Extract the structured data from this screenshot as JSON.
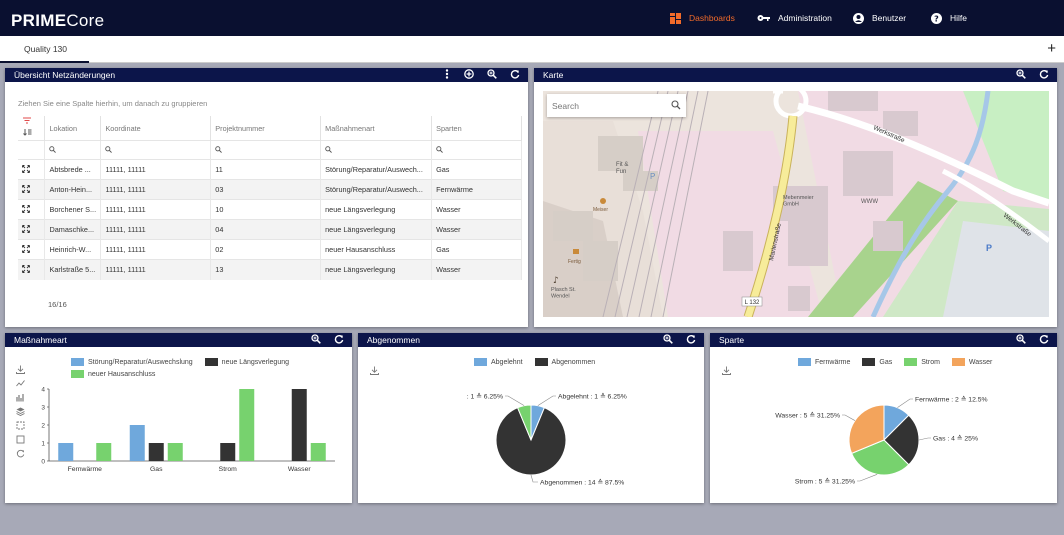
{
  "app": {
    "logo_bold": "PRIME",
    "logo_light": "Core",
    "nav": [
      {
        "label": "Dashboards",
        "icon": "dashboard-icon",
        "active": true
      },
      {
        "label": "Administration",
        "icon": "key-icon",
        "active": false
      },
      {
        "label": "Benutzer",
        "icon": "user-icon",
        "active": false
      },
      {
        "label": "Hilfe",
        "icon": "help-icon",
        "active": false
      }
    ],
    "accent": "#f26b2a",
    "header_color": "#0a1030"
  },
  "tabs": [
    {
      "label": "Quality 130"
    }
  ],
  "table_panel": {
    "title": "Übersicht Netzänderungen",
    "group_hint": "Ziehen Sie eine Spalte hierhin, um danach zu gruppieren",
    "columns": [
      "Lokation",
      "Koordinate",
      "Projektnummer",
      "Maßnahmenart",
      "Sparten"
    ],
    "rows": [
      [
        "Abtsbrede ...",
        "11111, 11111",
        "11",
        "Störung/Reparatur/Auswech...",
        "Gas"
      ],
      [
        "Anton-Hein...",
        "11111, 11111",
        "03",
        "Störung/Reparatur/Auswech...",
        "Fernwärme"
      ],
      [
        "Borchener S...",
        "11111, 11111",
        "10",
        "neue Längsverlegung",
        "Wasser"
      ],
      [
        "Damaschke...",
        "11111, 11111",
        "04",
        "neue Längsverlegung",
        "Wasser"
      ],
      [
        "Heinrich-W...",
        "11111, 11111",
        "02",
        "neuer Hausanschluss",
        "Gas"
      ],
      [
        "Karlstraße 5...",
        "11111, 11111",
        "13",
        "neue Längsverlegung",
        "Wasser"
      ]
    ],
    "count": "16/16"
  },
  "map_panel": {
    "title": "Karte",
    "search_placeholder": "Search",
    "labels": {
      "werkstrasse1": "Werkstraße",
      "werkstrasse2": "Werkstraße",
      "marienstrasse": "Marienstraße",
      "road": "L 132",
      "fitfun": "Fit &\nFun",
      "meiser": "Meiser",
      "meiser2": "Meiser",
      "mebenmeier": "Mebenmeier\nGmbH",
      "www": "WWW",
      "plasch": "Plasch St.\nWendel",
      "fertig": "Fertig",
      "p1": "P",
      "p2": "P"
    }
  },
  "chart_massnahmeart": {
    "title": "Maßnahmeart",
    "chart_data": {
      "type": "bar",
      "categories": [
        "Fernwärme",
        "Gas",
        "Strom",
        "Wasser"
      ],
      "series": [
        {
          "name": "Störung/Reparatur/Auswechslung",
          "color": "#6fa8dc",
          "values": [
            1,
            2,
            0,
            0
          ]
        },
        {
          "name": "neue Längsverlegung",
          "color": "#333333",
          "values": [
            0,
            1,
            1,
            4
          ]
        },
        {
          "name": "neuer Hausanschluss",
          "color": "#77d26e",
          "values": [
            1,
            1,
            4,
            1
          ]
        }
      ],
      "ylim": [
        0,
        4
      ],
      "yticks": [
        "0",
        "1",
        "2",
        "3",
        "4"
      ]
    }
  },
  "chart_abgenommen": {
    "title": "Abgenommen",
    "chart_data": {
      "type": "pie",
      "legend": [
        {
          "name": "Abgelehnt",
          "color": "#6fa8dc"
        },
        {
          "name": "Abgenommen",
          "color": "#333333"
        }
      ],
      "slices": [
        {
          "label": "Abgelehnt : 1 ≙ 6.25%",
          "value": 1,
          "color": "#6fa8dc"
        },
        {
          "label": "Abgenommen : 14 ≙ 87.5%",
          "value": 14,
          "color": "#333333"
        },
        {
          "label": ": 1 ≙ 6.25%",
          "value": 1,
          "color": "#77d26e"
        }
      ]
    }
  },
  "chart_sparte": {
    "title": "Sparte",
    "chart_data": {
      "type": "pie",
      "legend": [
        {
          "name": "Fernwärme",
          "color": "#6fa8dc"
        },
        {
          "name": "Gas",
          "color": "#333333"
        },
        {
          "name": "Strom",
          "color": "#77d26e"
        },
        {
          "name": "Wasser",
          "color": "#f3a45c"
        }
      ],
      "slices": [
        {
          "label": "Fernwärme : 2 ≙ 12.5%",
          "value": 2,
          "color": "#6fa8dc"
        },
        {
          "label": "Gas : 4 ≙ 25%",
          "value": 4,
          "color": "#333333"
        },
        {
          "label": "Strom : 5 ≙ 31.25%",
          "value": 5,
          "color": "#77d26e"
        },
        {
          "label": "Wasser : 5 ≙ 31.25%",
          "value": 5,
          "color": "#f3a45c"
        }
      ]
    }
  }
}
